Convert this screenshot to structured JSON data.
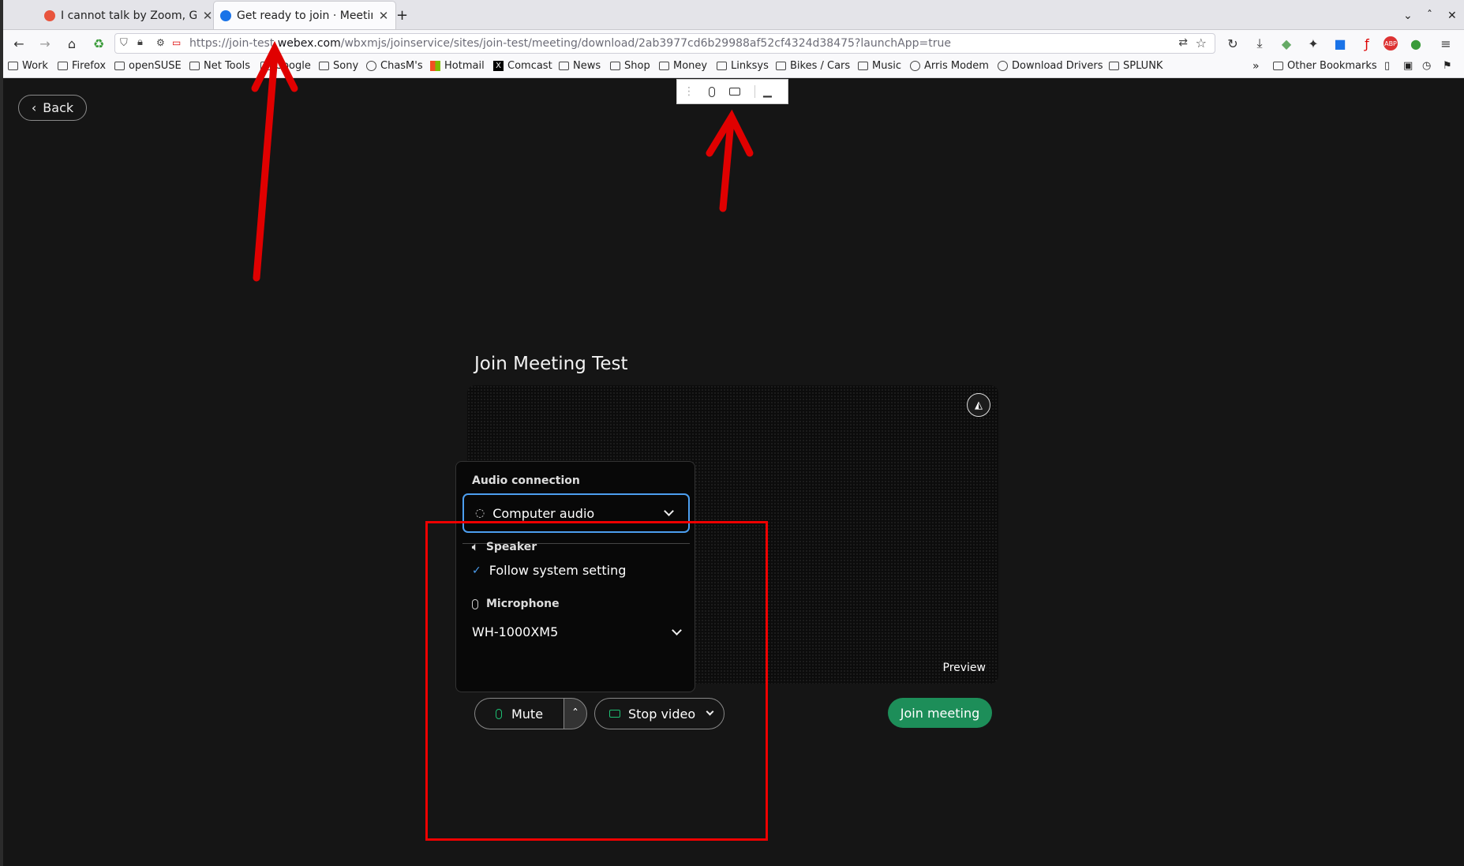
{
  "tabs": [
    {
      "title": "I cannot talk by Zoom, Goo",
      "favicon_color": "#e8543d"
    },
    {
      "title": "Get ready to join · Meeting",
      "favicon_color": "#1a73e8",
      "active": true
    }
  ],
  "tabbar": {
    "new_tab": "+"
  },
  "url": {
    "pre": "https://join-test.",
    "host": "webex.com",
    "path": "/wbxmjs/joinservice/sites/join-test/meeting/download/2ab3977cd6b29988af52cf4324d38475?launchApp=true"
  },
  "bookmarks": [
    {
      "label": "Work",
      "icon": "folder-icon"
    },
    {
      "label": "Firefox",
      "icon": "folder-icon"
    },
    {
      "label": "openSUSE",
      "icon": "folder-icon"
    },
    {
      "label": "Net Tools",
      "icon": "folder-icon"
    },
    {
      "label": "Google",
      "icon": "folder-icon"
    },
    {
      "label": "Sony",
      "icon": "folder-icon"
    },
    {
      "label": "ChasM's",
      "icon": "globe-icon"
    },
    {
      "label": "Hotmail",
      "icon": "microsoft-icon"
    },
    {
      "label": "Comcast",
      "icon": "x-icon"
    },
    {
      "label": "News",
      "icon": "folder-icon"
    },
    {
      "label": "Shop",
      "icon": "folder-icon"
    },
    {
      "label": "Money",
      "icon": "folder-icon"
    },
    {
      "label": "Linksys",
      "icon": "folder-icon"
    },
    {
      "label": "Bikes / Cars",
      "icon": "folder-icon"
    },
    {
      "label": "Music",
      "icon": "folder-icon"
    },
    {
      "label": "Arris Modem",
      "icon": "globe-icon"
    },
    {
      "label": "Download Drivers",
      "icon": "globe-icon"
    },
    {
      "label": "SPLUNK",
      "icon": "folder-icon"
    }
  ],
  "bookmarks_extra": {
    "other": "Other Bookmarks"
  },
  "page": {
    "back_label": "Back",
    "meeting_title": "Join Meeting Test",
    "preview_label": "Preview",
    "audio": {
      "heading": "Audio connection",
      "selected": "Computer audio",
      "speaker_heading": "Speaker",
      "speaker_value": "Follow system setting",
      "mic_heading": "Microphone",
      "mic_value": "WH-1000XM5"
    },
    "mute_label": "Mute",
    "video_label": "Stop video",
    "join_label": "Join meeting",
    "join_color": "#1d8e59",
    "accent_color": "#4c9eef"
  },
  "annotation_color": "#e00000"
}
